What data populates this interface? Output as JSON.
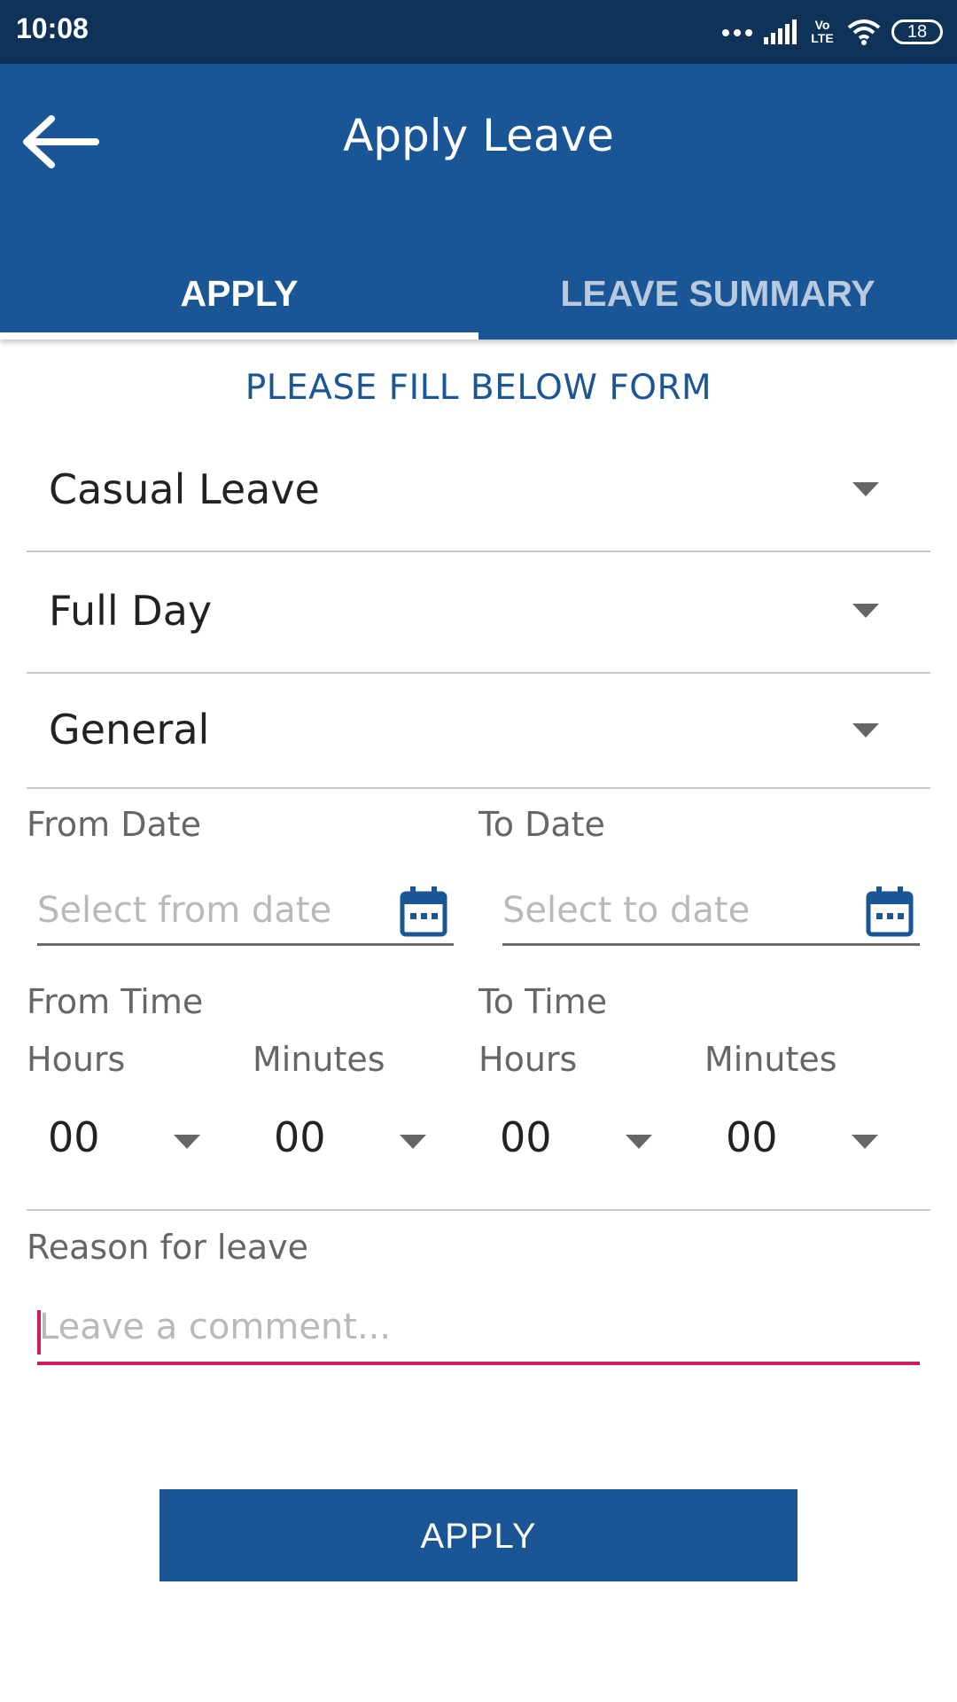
{
  "status_bar": {
    "time": "10:08",
    "network_label": "Vo LTE",
    "battery": "18"
  },
  "app_bar": {
    "title": "Apply Leave",
    "back_icon": "arrow-left-icon"
  },
  "tabs": [
    {
      "label": "APPLY",
      "active": true
    },
    {
      "label": "LEAVE SUMMARY",
      "active": false
    }
  ],
  "form": {
    "heading": "PLEASE FILL BELOW FORM",
    "leave_type": "Casual Leave",
    "day_type": "Full Day",
    "category": "General",
    "from_date": {
      "label": "From Date",
      "placeholder": "Select from date"
    },
    "to_date": {
      "label": "To Date",
      "placeholder": "Select to date"
    },
    "from_time": {
      "label": "From Time",
      "hours_label": "Hours",
      "minutes_label": "Minutes",
      "hours": "00",
      "minutes": "00"
    },
    "to_time": {
      "label": "To Time",
      "hours_label": "Hours",
      "minutes_label": "Minutes",
      "hours": "00",
      "minutes": "00"
    },
    "reason": {
      "label": "Reason for leave",
      "placeholder": "Leave a comment..."
    },
    "submit_label": "APPLY"
  },
  "colors": {
    "primary": "#1a5596",
    "status_bar": "#0f3259",
    "accent": "#cc1d5f",
    "inactive_tab": "#b9c9de"
  }
}
